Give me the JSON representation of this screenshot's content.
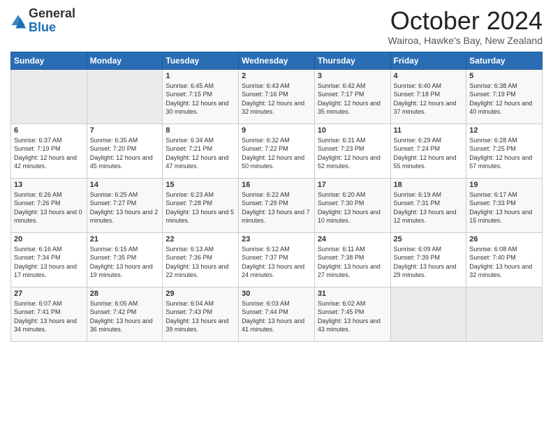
{
  "header": {
    "logo_general": "General",
    "logo_blue": "Blue",
    "month_title": "October 2024",
    "location": "Wairoa, Hawke's Bay, New Zealand"
  },
  "days_of_week": [
    "Sunday",
    "Monday",
    "Tuesday",
    "Wednesday",
    "Thursday",
    "Friday",
    "Saturday"
  ],
  "weeks": [
    [
      {
        "num": "",
        "sunrise": "",
        "sunset": "",
        "daylight": ""
      },
      {
        "num": "",
        "sunrise": "",
        "sunset": "",
        "daylight": ""
      },
      {
        "num": "1",
        "sunrise": "Sunrise: 6:45 AM",
        "sunset": "Sunset: 7:15 PM",
        "daylight": "Daylight: 12 hours and 30 minutes."
      },
      {
        "num": "2",
        "sunrise": "Sunrise: 6:43 AM",
        "sunset": "Sunset: 7:16 PM",
        "daylight": "Daylight: 12 hours and 32 minutes."
      },
      {
        "num": "3",
        "sunrise": "Sunrise: 6:42 AM",
        "sunset": "Sunset: 7:17 PM",
        "daylight": "Daylight: 12 hours and 35 minutes."
      },
      {
        "num": "4",
        "sunrise": "Sunrise: 6:40 AM",
        "sunset": "Sunset: 7:18 PM",
        "daylight": "Daylight: 12 hours and 37 minutes."
      },
      {
        "num": "5",
        "sunrise": "Sunrise: 6:38 AM",
        "sunset": "Sunset: 7:19 PM",
        "daylight": "Daylight: 12 hours and 40 minutes."
      }
    ],
    [
      {
        "num": "6",
        "sunrise": "Sunrise: 6:37 AM",
        "sunset": "Sunset: 7:19 PM",
        "daylight": "Daylight: 12 hours and 42 minutes."
      },
      {
        "num": "7",
        "sunrise": "Sunrise: 6:35 AM",
        "sunset": "Sunset: 7:20 PM",
        "daylight": "Daylight: 12 hours and 45 minutes."
      },
      {
        "num": "8",
        "sunrise": "Sunrise: 6:34 AM",
        "sunset": "Sunset: 7:21 PM",
        "daylight": "Daylight: 12 hours and 47 minutes."
      },
      {
        "num": "9",
        "sunrise": "Sunrise: 6:32 AM",
        "sunset": "Sunset: 7:22 PM",
        "daylight": "Daylight: 12 hours and 50 minutes."
      },
      {
        "num": "10",
        "sunrise": "Sunrise: 6:31 AM",
        "sunset": "Sunset: 7:23 PM",
        "daylight": "Daylight: 12 hours and 52 minutes."
      },
      {
        "num": "11",
        "sunrise": "Sunrise: 6:29 AM",
        "sunset": "Sunset: 7:24 PM",
        "daylight": "Daylight: 12 hours and 55 minutes."
      },
      {
        "num": "12",
        "sunrise": "Sunrise: 6:28 AM",
        "sunset": "Sunset: 7:25 PM",
        "daylight": "Daylight: 12 hours and 57 minutes."
      }
    ],
    [
      {
        "num": "13",
        "sunrise": "Sunrise: 6:26 AM",
        "sunset": "Sunset: 7:26 PM",
        "daylight": "Daylight: 13 hours and 0 minutes."
      },
      {
        "num": "14",
        "sunrise": "Sunrise: 6:25 AM",
        "sunset": "Sunset: 7:27 PM",
        "daylight": "Daylight: 13 hours and 2 minutes."
      },
      {
        "num": "15",
        "sunrise": "Sunrise: 6:23 AM",
        "sunset": "Sunset: 7:28 PM",
        "daylight": "Daylight: 13 hours and 5 minutes."
      },
      {
        "num": "16",
        "sunrise": "Sunrise: 6:22 AM",
        "sunset": "Sunset: 7:29 PM",
        "daylight": "Daylight: 13 hours and 7 minutes."
      },
      {
        "num": "17",
        "sunrise": "Sunrise: 6:20 AM",
        "sunset": "Sunset: 7:30 PM",
        "daylight": "Daylight: 13 hours and 10 minutes."
      },
      {
        "num": "18",
        "sunrise": "Sunrise: 6:19 AM",
        "sunset": "Sunset: 7:31 PM",
        "daylight": "Daylight: 13 hours and 12 minutes."
      },
      {
        "num": "19",
        "sunrise": "Sunrise: 6:17 AM",
        "sunset": "Sunset: 7:33 PM",
        "daylight": "Daylight: 13 hours and 15 minutes."
      }
    ],
    [
      {
        "num": "20",
        "sunrise": "Sunrise: 6:16 AM",
        "sunset": "Sunset: 7:34 PM",
        "daylight": "Daylight: 13 hours and 17 minutes."
      },
      {
        "num": "21",
        "sunrise": "Sunrise: 6:15 AM",
        "sunset": "Sunset: 7:35 PM",
        "daylight": "Daylight: 13 hours and 19 minutes."
      },
      {
        "num": "22",
        "sunrise": "Sunrise: 6:13 AM",
        "sunset": "Sunset: 7:36 PM",
        "daylight": "Daylight: 13 hours and 22 minutes."
      },
      {
        "num": "23",
        "sunrise": "Sunrise: 6:12 AM",
        "sunset": "Sunset: 7:37 PM",
        "daylight": "Daylight: 13 hours and 24 minutes."
      },
      {
        "num": "24",
        "sunrise": "Sunrise: 6:11 AM",
        "sunset": "Sunset: 7:38 PM",
        "daylight": "Daylight: 13 hours and 27 minutes."
      },
      {
        "num": "25",
        "sunrise": "Sunrise: 6:09 AM",
        "sunset": "Sunset: 7:39 PM",
        "daylight": "Daylight: 13 hours and 29 minutes."
      },
      {
        "num": "26",
        "sunrise": "Sunrise: 6:08 AM",
        "sunset": "Sunset: 7:40 PM",
        "daylight": "Daylight: 13 hours and 32 minutes."
      }
    ],
    [
      {
        "num": "27",
        "sunrise": "Sunrise: 6:07 AM",
        "sunset": "Sunset: 7:41 PM",
        "daylight": "Daylight: 13 hours and 34 minutes."
      },
      {
        "num": "28",
        "sunrise": "Sunrise: 6:05 AM",
        "sunset": "Sunset: 7:42 PM",
        "daylight": "Daylight: 13 hours and 36 minutes."
      },
      {
        "num": "29",
        "sunrise": "Sunrise: 6:04 AM",
        "sunset": "Sunset: 7:43 PM",
        "daylight": "Daylight: 13 hours and 39 minutes."
      },
      {
        "num": "30",
        "sunrise": "Sunrise: 6:03 AM",
        "sunset": "Sunset: 7:44 PM",
        "daylight": "Daylight: 13 hours and 41 minutes."
      },
      {
        "num": "31",
        "sunrise": "Sunrise: 6:02 AM",
        "sunset": "Sunset: 7:45 PM",
        "daylight": "Daylight: 13 hours and 43 minutes."
      },
      {
        "num": "",
        "sunrise": "",
        "sunset": "",
        "daylight": ""
      },
      {
        "num": "",
        "sunrise": "",
        "sunset": "",
        "daylight": ""
      }
    ]
  ]
}
